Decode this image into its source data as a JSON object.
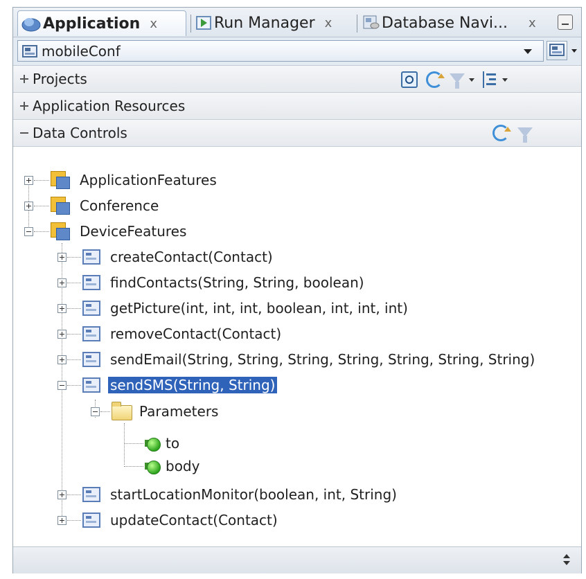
{
  "tabs": [
    {
      "label": "Application",
      "close": "x",
      "active": true
    },
    {
      "label": "Run Manager",
      "close": "x",
      "active": false
    },
    {
      "label": "Database Navi...",
      "close": "x",
      "active": false
    }
  ],
  "selector": {
    "value": "mobileConf"
  },
  "sections": [
    {
      "title": "Projects",
      "expanded": false
    },
    {
      "title": "Application Resources",
      "expanded": false
    },
    {
      "title": "Data Controls",
      "expanded": true
    }
  ],
  "tree": {
    "roots": [
      {
        "label": "ApplicationFeatures",
        "expanded": false
      },
      {
        "label": "Conference",
        "expanded": false
      },
      {
        "label": "DeviceFeatures",
        "expanded": true
      }
    ],
    "methods": [
      {
        "label": "createContact(Contact)"
      },
      {
        "label": "findContacts(String, String, boolean)"
      },
      {
        "label": "getPicture(int, int, int, boolean, int, int, int)"
      },
      {
        "label": "removeContact(Contact)"
      },
      {
        "label": "sendEmail(String, String, String, String, String, String, String)"
      },
      {
        "label": "sendSMS(String, String)",
        "selected": true
      },
      {
        "label": "startLocationMonitor(boolean, int, String)"
      },
      {
        "label": "updateContact(Contact)"
      }
    ],
    "parameters_label": "Parameters",
    "params": [
      {
        "label": "to"
      },
      {
        "label": "body"
      }
    ]
  },
  "colors": {
    "selection": "#2f63b9",
    "tab_border": "#9db1c8"
  },
  "icons": [
    "application-icon",
    "run-manager-icon",
    "database-navigator-icon",
    "minimize-icon",
    "window-icon",
    "search-icon",
    "refresh-icon",
    "filter-icon",
    "tree-options-icon",
    "data-control-icon",
    "method-icon",
    "folder-icon",
    "parameter-icon",
    "scroll-icon"
  ]
}
